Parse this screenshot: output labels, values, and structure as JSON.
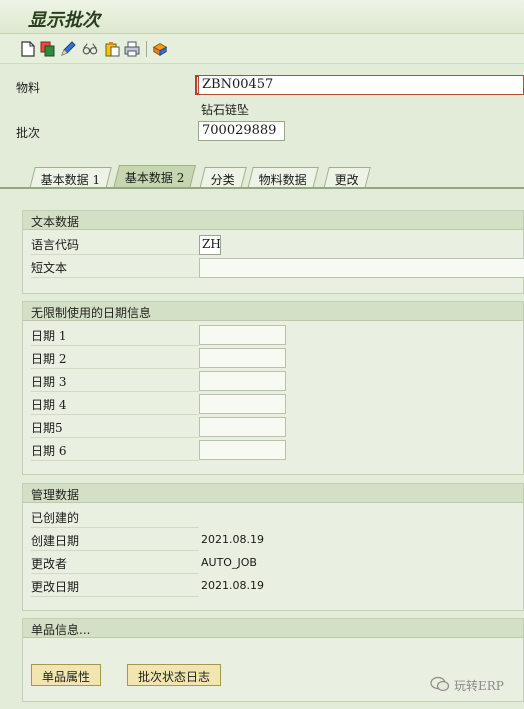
{
  "window": {
    "title": "显示批次"
  },
  "toolbar": {
    "icons": [
      "new-document-icon",
      "copy-icon",
      "edit-pencil-icon",
      "display-glasses-icon",
      "clipboard-icon",
      "print-icon",
      "config-icon"
    ]
  },
  "header": {
    "material_label": "物料",
    "material_value": "ZBN00457",
    "material_desc": "钻石链坠",
    "batch_label": "批次",
    "batch_value": "700029889"
  },
  "tabs": [
    {
      "label": "基本数据 1"
    },
    {
      "label": "基本数据 2"
    },
    {
      "label": "分类"
    },
    {
      "label": "物料数据"
    },
    {
      "label": "更改"
    }
  ],
  "text_data": {
    "title": "文本数据",
    "language_label": "语言代码",
    "language_value": "ZH",
    "short_text_label": "短文本",
    "short_text_value": ""
  },
  "dates": {
    "title": "无限制使用的日期信息",
    "rows": [
      {
        "label": "日期 1",
        "value": ""
      },
      {
        "label": "日期 2",
        "value": ""
      },
      {
        "label": "日期 3",
        "value": ""
      },
      {
        "label": "日期 4",
        "value": ""
      },
      {
        "label": "日期5",
        "value": ""
      },
      {
        "label": "日期 6",
        "value": ""
      }
    ]
  },
  "admin": {
    "title": "管理数据",
    "created_label": "已创建的",
    "created_date_label": "创建日期",
    "created_date_value": "2021.08.19",
    "changed_by_label": "更改者",
    "changed_by_value": "AUTO_JOB",
    "changed_date_label": "更改日期",
    "changed_date_value": "2021.08.19"
  },
  "single": {
    "title": "单品信息...",
    "btn_attributes": "单品属性",
    "btn_status_log": "批次状态日志"
  },
  "watermark": {
    "text": "玩转ERP"
  }
}
